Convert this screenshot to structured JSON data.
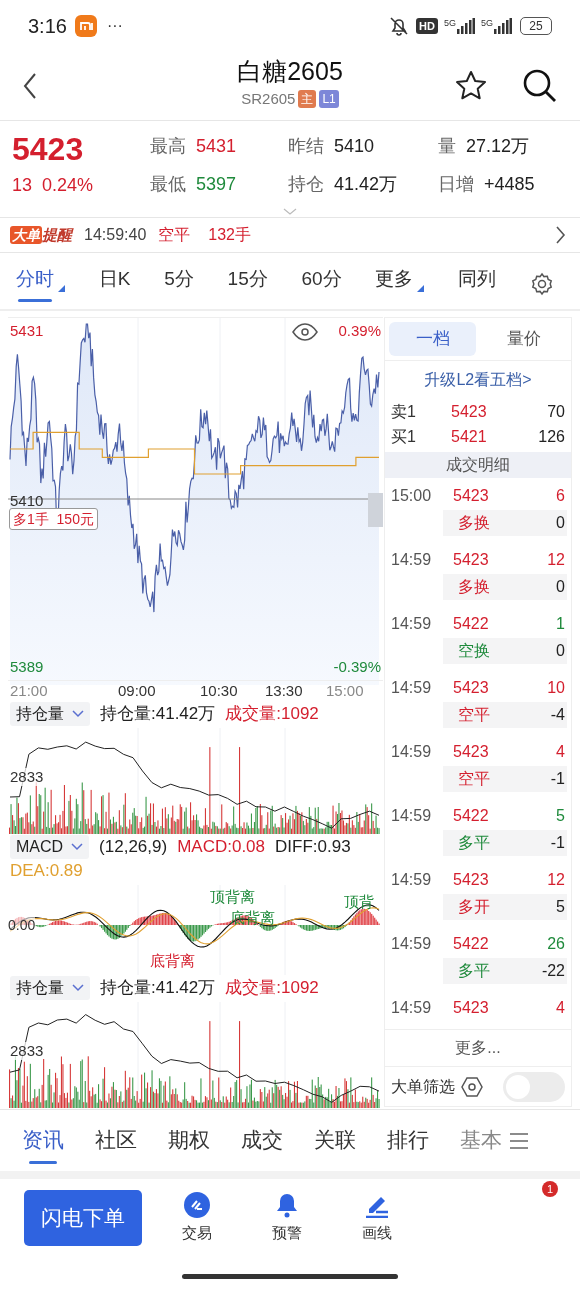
{
  "status_bar": {
    "time": "3:16",
    "dots": "···",
    "hd": "HD",
    "network_1": "5G",
    "network_2": "5G",
    "battery": "25"
  },
  "header": {
    "title": "白糖2605",
    "code": "SR2605",
    "tags": [
      {
        "text": "主",
        "color": "#e07b4f"
      },
      {
        "text": "L1",
        "color": "#7d87d8"
      }
    ]
  },
  "quote": {
    "price": "5423",
    "change": "13",
    "change_pct": "0.24%",
    "stats": [
      {
        "label": "最高",
        "value": "5431",
        "color": "#d41f2e"
      },
      {
        "label": "昨结",
        "value": "5410",
        "color": "#222222"
      },
      {
        "label": "量",
        "value": "27.12万",
        "color": "#222222"
      },
      {
        "label": "最低",
        "value": "5397",
        "color": "#1f8a3c"
      },
      {
        "label": "持仓",
        "value": "41.42万",
        "color": "#222222"
      },
      {
        "label": "日增",
        "value": "+4485",
        "color": "#222222"
      }
    ]
  },
  "alert": {
    "badge": "大单",
    "title": "提醒",
    "time": "14:59:40",
    "action": "空平",
    "size": "132手"
  },
  "period_tabs": [
    {
      "label": "分时",
      "selected": true,
      "menu": true
    },
    {
      "label": "日K",
      "selected": false,
      "menu": false
    },
    {
      "label": "5分",
      "selected": false,
      "menu": false
    },
    {
      "label": "15分",
      "selected": false,
      "menu": false
    },
    {
      "label": "60分",
      "selected": false,
      "menu": false
    },
    {
      "label": "更多",
      "selected": false,
      "menu": true
    },
    {
      "label": "同列",
      "selected": false,
      "menu": false
    }
  ],
  "chart": {
    "high": "5431",
    "high_pct": "0.39%",
    "base": "5410",
    "low": "5389",
    "low_pct": "-0.39%",
    "position_tag": "多1手  150元",
    "times": [
      "21:00",
      "09:00",
      "10:30",
      "13:30",
      "15:00"
    ]
  },
  "indicators": [
    {
      "kind": "volume",
      "selector": "持仓量",
      "values": [
        {
          "text": "持仓量:41.42万",
          "color": "#222222"
        },
        {
          "text": "成交量:1092",
          "color": "#d41f2e"
        }
      ],
      "axis_label": "2833"
    },
    {
      "kind": "macd",
      "selector": "MACD",
      "values": [
        {
          "text": "(12,26,9)",
          "color": "#222222"
        },
        {
          "text": "MACD:0.08",
          "color": "#d41f2e"
        },
        {
          "text": "DIFF:0.93",
          "color": "#222222"
        },
        {
          "text": "DEA:0.89",
          "color": "#e0a030"
        }
      ],
      "axis_label": "0.00",
      "signals": [
        {
          "text": "底背离",
          "color": "#d41f2e"
        },
        {
          "text": "顶背离",
          "color": "#1f8a3c"
        },
        {
          "text": "底背离",
          "color": "#1f8a3c"
        },
        {
          "text": "顶背",
          "color": "#1f8a3c"
        }
      ]
    },
    {
      "kind": "volume",
      "selector": "持仓量",
      "values": [
        {
          "text": "持仓量:41.42万",
          "color": "#222222"
        },
        {
          "text": "成交量:1092",
          "color": "#d41f2e"
        }
      ],
      "axis_label": "2833"
    }
  ],
  "order_book": {
    "tabs": [
      {
        "label": "一档",
        "selected": true
      },
      {
        "label": "量价",
        "selected": false
      }
    ],
    "upgrade_link": "升级L2看五档>",
    "levels": [
      {
        "side": "卖1",
        "price": "5423",
        "volume": "70"
      },
      {
        "side": "买1",
        "price": "5421",
        "volume": "126"
      }
    ],
    "trades_title": "成交明细",
    "trades": [
      {
        "time": "15:00",
        "price": "5423",
        "volume": "6",
        "type": "多换",
        "change": "0",
        "color": "#d41f2e"
      },
      {
        "time": "14:59",
        "price": "5423",
        "volume": "12",
        "type": "多换",
        "change": "0",
        "color": "#d41f2e"
      },
      {
        "time": "14:59",
        "price": "5422",
        "volume": "1",
        "type": "空换",
        "change": "0",
        "color": "#1f8a3c"
      },
      {
        "time": "14:59",
        "price": "5423",
        "volume": "10",
        "type": "空平",
        "change": "-4",
        "color": "#d41f2e"
      },
      {
        "time": "14:59",
        "price": "5423",
        "volume": "4",
        "type": "空平",
        "change": "-1",
        "color": "#d41f2e"
      },
      {
        "time": "14:59",
        "price": "5422",
        "volume": "5",
        "type": "多平",
        "change": "-1",
        "color": "#1f8a3c"
      },
      {
        "time": "14:59",
        "price": "5423",
        "volume": "12",
        "type": "多开",
        "change": "5",
        "color": "#d41f2e"
      },
      {
        "time": "14:59",
        "price": "5422",
        "volume": "26",
        "type": "多平",
        "change": "-22",
        "color": "#1f8a3c"
      },
      {
        "time": "14:59",
        "price": "5423",
        "volume": "4",
        "color": "#d41f2e"
      }
    ],
    "more": "更多...",
    "filter": {
      "label": "大单筛选",
      "on": false
    }
  },
  "bottom_tabs": [
    {
      "label": "资讯",
      "selected": true
    },
    {
      "label": "社区",
      "selected": false
    },
    {
      "label": "期权",
      "selected": false
    },
    {
      "label": "成交",
      "selected": false
    },
    {
      "label": "关联",
      "selected": false
    },
    {
      "label": "排行",
      "selected": false
    },
    {
      "label": "基本",
      "selected": false
    }
  ],
  "actions": {
    "primary": "闪电下单",
    "items": [
      {
        "kind": "trade",
        "label": "交易"
      },
      {
        "kind": "alert",
        "label": "预警"
      },
      {
        "kind": "draw",
        "label": "画线"
      }
    ],
    "notification_count": "1"
  }
}
